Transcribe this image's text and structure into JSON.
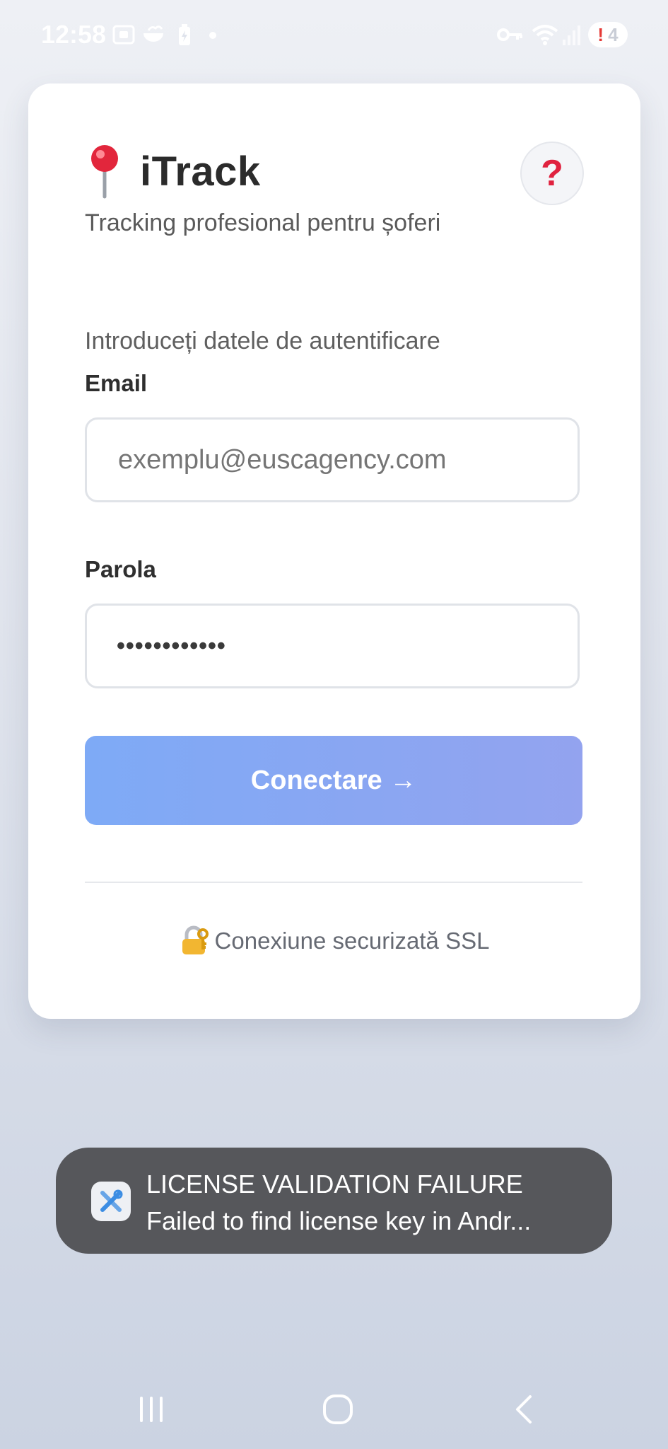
{
  "status_bar": {
    "time": "12:58",
    "badge_alert": "!",
    "badge_count": "4",
    "icons": [
      "screenshot-icon",
      "bowl-icon",
      "battery-icon",
      "key-icon",
      "wifi-icon",
      "signal-icon"
    ]
  },
  "card": {
    "app_icon": "map-pin-icon",
    "app_title": "iTrack",
    "subtitle": "Tracking profesional pentru șoferi",
    "help_label": "?",
    "instructions": "Introduceți datele de autentificare",
    "email": {
      "label": "Email",
      "placeholder": "exemplu@euscagency.com",
      "value": ""
    },
    "password": {
      "label": "Parola",
      "masked_value": "••••••••••••"
    },
    "submit_label": "Conectare →",
    "ssl_icon": "lock-with-key-icon",
    "ssl_text": "Conexiune securizată SSL"
  },
  "toast": {
    "icon": "tools-icon",
    "line1": "LICENSE VALIDATION FAILURE",
    "line2": "Failed to find license key in Andr..."
  },
  "nav_bar": {
    "buttons": [
      "recent-apps-icon",
      "home-icon",
      "back-icon"
    ]
  },
  "colors": {
    "accent_gradient_start": "#7eaaf6",
    "accent_gradient_end": "#93a3ef",
    "help_mark": "#e0223f",
    "toast_background": "#56575b"
  }
}
